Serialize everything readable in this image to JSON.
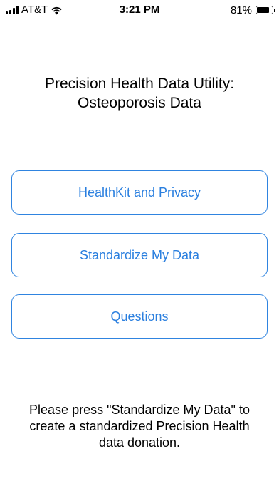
{
  "status_bar": {
    "carrier": "AT&T",
    "time": "3:21 PM",
    "battery_percent_text": "81%",
    "battery_level": 0.81
  },
  "title": {
    "line1": "Precision Health Data Utility:",
    "line2": "Osteoporosis Data"
  },
  "buttons": [
    {
      "label": "HealthKit and Privacy"
    },
    {
      "label": "Standardize My Data"
    },
    {
      "label": "Questions"
    }
  ],
  "footer": {
    "line1": "Please press \"Standardize My Data\" to",
    "line2": "create a standardized Precision Health",
    "line3": "data donation."
  },
  "colors": {
    "accent": "#2a7fdf",
    "background": "#ffffff",
    "text": "#000000"
  }
}
